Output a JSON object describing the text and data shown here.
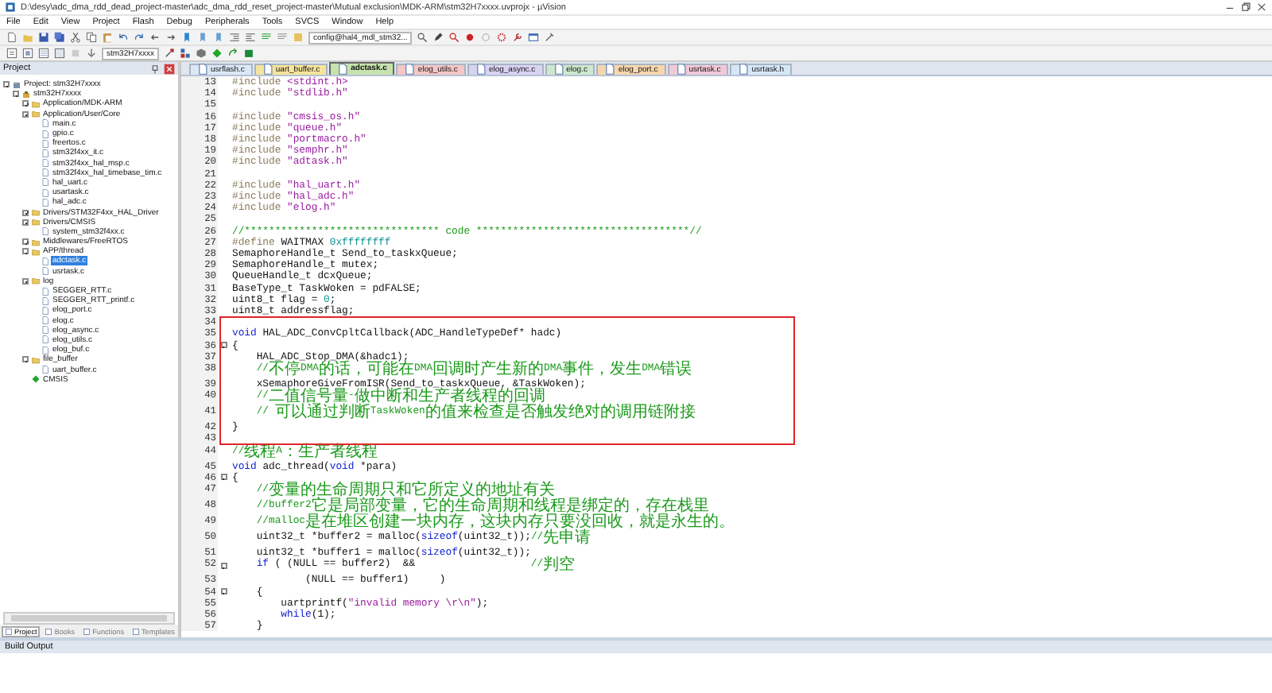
{
  "window": {
    "title": "D:\\desy\\adc_dma_rdd_dead_project-master\\adc_dma_rdd_reset_project-master\\Mutual exclusion\\MDK-ARM\\stm32H7xxxx.uvprojx - µVision"
  },
  "menu": [
    "File",
    "Edit",
    "View",
    "Project",
    "Flash",
    "Debug",
    "Peripherals",
    "Tools",
    "SVCS",
    "Window",
    "Help"
  ],
  "toolbar": {
    "config_field": "config@hal4_mdl_stm32...",
    "target_field": "stm32H7xxxx"
  },
  "project_panel": {
    "title": "Project",
    "tree": [
      {
        "label": "Project: stm32H7xxxx",
        "kind": "project",
        "expanded": true,
        "selected": false,
        "children": [
          {
            "label": "stm32H7xxxx",
            "kind": "target",
            "expanded": true,
            "selected": false,
            "children": [
              {
                "label": "Application/MDK-ARM",
                "kind": "folder",
                "expanded": false,
                "selected": false
              },
              {
                "label": "Application/User/Core",
                "kind": "folder",
                "expanded": true,
                "selected": false,
                "children": [
                  {
                    "label": "main.c",
                    "kind": "file",
                    "selected": false
                  },
                  {
                    "label": "gpio.c",
                    "kind": "file",
                    "selected": false
                  },
                  {
                    "label": "freertos.c",
                    "kind": "file",
                    "selected": false
                  },
                  {
                    "label": "stm32f4xx_it.c",
                    "kind": "file",
                    "selected": false
                  },
                  {
                    "label": "stm32f4xx_hal_msp.c",
                    "kind": "file",
                    "selected": false
                  },
                  {
                    "label": "stm32f4xx_hal_timebase_tim.c",
                    "kind": "file",
                    "selected": false
                  },
                  {
                    "label": "hal_uart.c",
                    "kind": "file",
                    "selected": false
                  },
                  {
                    "label": "usartask.c",
                    "kind": "file",
                    "selected": false
                  },
                  {
                    "label": "hal_adc.c",
                    "kind": "file",
                    "selected": false
                  }
                ]
              },
              {
                "label": "Drivers/STM32F4xx_HAL_Driver",
                "kind": "folder",
                "expanded": false,
                "selected": false
              },
              {
                "label": "Drivers/CMSIS",
                "kind": "folder",
                "expanded": true,
                "selected": false,
                "children": [
                  {
                    "label": "system_stm32f4xx.c",
                    "kind": "file",
                    "selected": false
                  }
                ]
              },
              {
                "label": "Middlewares/FreeRTOS",
                "kind": "folder",
                "expanded": false,
                "selected": false
              },
              {
                "label": "APP/thread",
                "kind": "folder",
                "expanded": true,
                "selected": false,
                "children": [
                  {
                    "label": "adctask.c",
                    "kind": "file",
                    "selected": true
                  },
                  {
                    "label": "usrtask.c",
                    "kind": "file",
                    "selected": false
                  }
                ]
              },
              {
                "label": "log",
                "kind": "folder",
                "expanded": true,
                "selected": false,
                "children": [
                  {
                    "label": "SEGGER_RTT.c",
                    "kind": "file",
                    "selected": false
                  },
                  {
                    "label": "SEGGER_RTT_printf.c",
                    "kind": "file",
                    "selected": false
                  },
                  {
                    "label": "elog_port.c",
                    "kind": "file",
                    "selected": false
                  },
                  {
                    "label": "elog.c",
                    "kind": "file",
                    "selected": false
                  },
                  {
                    "label": "elog_async.c",
                    "kind": "file",
                    "selected": false
                  },
                  {
                    "label": "elog_utils.c",
                    "kind": "file",
                    "selected": false
                  },
                  {
                    "label": "elog_buf.c",
                    "kind": "file",
                    "selected": false
                  }
                ]
              },
              {
                "label": "file_buffer",
                "kind": "folder",
                "expanded": true,
                "selected": false,
                "children": [
                  {
                    "label": "uart_buffer.c",
                    "kind": "file",
                    "selected": false
                  }
                ]
              },
              {
                "label": "CMSIS",
                "kind": "component",
                "selected": false
              }
            ]
          }
        ]
      }
    ],
    "tabs": [
      {
        "label": "Project",
        "selected": true
      },
      {
        "label": "Books",
        "selected": false
      },
      {
        "label": "Functions",
        "selected": false
      },
      {
        "label": "Templates",
        "selected": false
      }
    ]
  },
  "editor_tabs": [
    {
      "label": "usrflash.c",
      "selected": false,
      "color": "#dce8f6"
    },
    {
      "label": "uart_buffer.c",
      "selected": false,
      "color": "#f6e49c"
    },
    {
      "label": "adctask.c",
      "selected": true,
      "color": "#c6e3ad"
    },
    {
      "label": "elog_utils.c",
      "selected": false,
      "color": "#f4c6c6"
    },
    {
      "label": "elog_async.c",
      "selected": false,
      "color": "#d9d2f2"
    },
    {
      "label": "elog.c",
      "selected": false,
      "color": "#cde8cd"
    },
    {
      "label": "elog_port.c",
      "selected": false,
      "color": "#f7d6ae"
    },
    {
      "label": "usrtask.c",
      "selected": false,
      "color": "#f1c8d8"
    },
    {
      "label": "usrtask.h",
      "selected": false,
      "color": "#d6e7f8"
    }
  ],
  "code": {
    "before": [
      {
        "n": "13",
        "fold": false,
        "segs": [
          {
            "kind": "pp",
            "text": "#include "
          },
          {
            "kind": "str",
            "text": "<stdint.h>"
          }
        ]
      },
      {
        "n": "14",
        "fold": false,
        "segs": [
          {
            "kind": "pp",
            "text": "#include "
          },
          {
            "kind": "str",
            "text": "\"stdlib.h\""
          }
        ]
      },
      {
        "n": "15",
        "fold": false
      },
      {
        "n": "16",
        "fold": false,
        "segs": [
          {
            "kind": "pp",
            "text": "#include "
          },
          {
            "kind": "str",
            "text": "\"cmsis_os.h\""
          }
        ]
      },
      {
        "n": "17",
        "fold": false,
        "segs": [
          {
            "kind": "pp",
            "text": "#include "
          },
          {
            "kind": "str",
            "text": "\"queue.h\""
          }
        ]
      },
      {
        "n": "18",
        "fold": false,
        "segs": [
          {
            "kind": "pp",
            "text": "#include "
          },
          {
            "kind": "str",
            "text": "\"portmacro.h\""
          }
        ]
      },
      {
        "n": "19",
        "fold": false,
        "segs": [
          {
            "kind": "pp",
            "text": "#include "
          },
          {
            "kind": "str",
            "text": "\"semphr.h\""
          }
        ]
      },
      {
        "n": "20",
        "fold": false,
        "segs": [
          {
            "kind": "pp",
            "text": "#include "
          },
          {
            "kind": "str",
            "text": "\"adtask.h\""
          }
        ]
      },
      {
        "n": "21",
        "fold": false
      },
      {
        "n": "22",
        "fold": false,
        "segs": [
          {
            "kind": "pp",
            "text": "#include "
          },
          {
            "kind": "str",
            "text": "\"hal_uart.h\""
          }
        ]
      },
      {
        "n": "23",
        "fold": false,
        "segs": [
          {
            "kind": "pp",
            "text": "#include "
          },
          {
            "kind": "str",
            "text": "\"hal_adc.h\""
          }
        ]
      },
      {
        "n": "24",
        "fold": false,
        "segs": [
          {
            "kind": "pp",
            "text": "#include "
          },
          {
            "kind": "str",
            "text": "\"elog.h\""
          }
        ]
      },
      {
        "n": "25",
        "fold": false
      },
      {
        "n": "26",
        "fold": false,
        "segs": [
          {
            "kind": "cmt",
            "text": "//******************************** code ***********************************//"
          }
        ]
      },
      {
        "n": "27",
        "fold": false,
        "segs": [
          {
            "kind": "pp",
            "text": "#define "
          },
          {
            "kind": "plain",
            "text": "WAITMAX "
          },
          {
            "kind": "num",
            "text": "0xffffffff"
          }
        ]
      },
      {
        "n": "28",
        "fold": false,
        "segs": [
          {
            "kind": "plain",
            "text": "SemaphoreHandle_t Send_to_taskxQueue;"
          }
        ]
      },
      {
        "n": "29",
        "fold": false,
        "segs": [
          {
            "kind": "plain",
            "text": "SemaphoreHandle_t mutex;"
          }
        ]
      },
      {
        "n": "30",
        "fold": false,
        "segs": [
          {
            "kind": "plain",
            "text": "QueueHandle_t dcxQueue;"
          }
        ]
      },
      {
        "n": "31",
        "fold": false,
        "segs": [
          {
            "kind": "plain",
            "text": "BaseType_t TaskWoken = pdFALSE;"
          }
        ]
      },
      {
        "n": "32",
        "fold": false,
        "segs": [
          {
            "kind": "plain",
            "text": "uint8_t flag = "
          },
          {
            "kind": "num",
            "text": "0"
          },
          {
            "kind": "plain",
            "text": ";"
          }
        ]
      },
      {
        "n": "33",
        "fold": false,
        "segs": [
          {
            "kind": "plain",
            "text": "uint8_t addressflag;"
          }
        ]
      }
    ],
    "boxed": [
      {
        "n": "34",
        "fold": false
      },
      {
        "n": "35",
        "fold": false,
        "segs": [
          {
            "kind": "kw",
            "text": "void "
          },
          {
            "kind": "plain",
            "text": "HAL_ADC_ConvCpltCallback(ADC_HandleTypeDef* hadc)"
          }
        ]
      },
      {
        "n": "36",
        "fold": true,
        "segs": [
          {
            "kind": "plain",
            "text": "{"
          }
        ]
      },
      {
        "n": "37",
        "fold": false,
        "segs": [
          {
            "kind": "plain",
            "text": "    HAL_ADC_Stop_DMA(&hadc1);"
          }
        ]
      },
      {
        "n": "38",
        "fold": false,
        "segs": [
          {
            "kind": "cmt",
            "text": "    //不停DMA的话，可能在DMA回调时产生新的DMA事件，发生DMA错误"
          }
        ]
      },
      {
        "n": "39",
        "fold": false,
        "segs": [
          {
            "kind": "plain",
            "text": "    xSemaphoreGiveFromISR(Send_to_taskxQueue, &TaskWoken);"
          }
        ]
      },
      {
        "n": "40",
        "fold": false,
        "segs": [
          {
            "kind": "cmt",
            "text": "    //二值信号量-做中断和生产者线程的回调"
          }
        ]
      },
      {
        "n": "41",
        "fold": false,
        "segs": [
          {
            "kind": "cmt",
            "text": "    // 可以通过判断TaskWoken的值来检查是否触发绝对的调用链附接"
          }
        ]
      },
      {
        "n": "42",
        "fold": false,
        "segs": [
          {
            "kind": "plain",
            "text": "}"
          }
        ]
      },
      {
        "n": "43",
        "fold": false
      }
    ],
    "after": [
      {
        "n": "44",
        "fold": false,
        "segs": [
          {
            "kind": "cmt",
            "text": "//线程A：生产者线程"
          }
        ]
      },
      {
        "n": "45",
        "fold": false,
        "segs": [
          {
            "kind": "kw",
            "text": "void "
          },
          {
            "kind": "plain",
            "text": "adc_thread("
          },
          {
            "kind": "kw",
            "text": "void"
          },
          {
            "kind": "plain",
            "text": " *para)"
          }
        ]
      },
      {
        "n": "46",
        "fold": true,
        "segs": [
          {
            "kind": "plain",
            "text": "{"
          }
        ]
      },
      {
        "n": "47",
        "fold": false,
        "segs": [
          {
            "kind": "cmt",
            "text": "    //变量的生命周期只和它所定义的地址有关"
          }
        ]
      },
      {
        "n": "48",
        "fold": false,
        "segs": [
          {
            "kind": "cmt",
            "text": "    //buffer2它是局部变量，它的生命周期和线程是绑定的，存在栈里"
          }
        ]
      },
      {
        "n": "49",
        "fold": false,
        "segs": [
          {
            "kind": "cmt",
            "text": "    //malloc是在堆区创建一块内存，这块内存只要没回收，就是永生的。"
          }
        ]
      },
      {
        "n": "50",
        "fold": false,
        "segs": [
          {
            "kind": "plain",
            "text": "    uint32_t *buffer2 = malloc("
          },
          {
            "kind": "kw",
            "text": "sizeof"
          },
          {
            "kind": "plain",
            "text": "(uint32_t));"
          },
          {
            "kind": "cmt",
            "text": "//先申请"
          }
        ]
      },
      {
        "n": "51",
        "fold": false,
        "segs": [
          {
            "kind": "plain",
            "text": "    uint32_t *buffer1 = malloc("
          },
          {
            "kind": "kw",
            "text": "sizeof"
          },
          {
            "kind": "plain",
            "text": "(uint32_t));"
          }
        ]
      },
      {
        "n": "52",
        "fold": true,
        "segs": [
          {
            "kind": "kw",
            "text": "    if"
          },
          {
            "kind": "plain",
            "text": " ( (NULL == buffer2)  &&                   "
          },
          {
            "kind": "cmt",
            "text": "//判空"
          }
        ]
      },
      {
        "n": "53",
        "fold": false,
        "segs": [
          {
            "kind": "plain",
            "text": "            (NULL == buffer1)     )"
          }
        ]
      },
      {
        "n": "54",
        "fold": true,
        "segs": [
          {
            "kind": "plain",
            "text": "    {"
          }
        ]
      },
      {
        "n": "55",
        "fold": false,
        "segs": [
          {
            "kind": "plain",
            "text": "        uartprintf("
          },
          {
            "kind": "str",
            "text": "\"invalid memory \\r\\n\""
          },
          {
            "kind": "plain",
            "text": ");"
          }
        ]
      },
      {
        "n": "56",
        "fold": false,
        "segs": [
          {
            "kind": "kw",
            "text": "        while"
          },
          {
            "kind": "plain",
            "text": "(1);"
          }
        ]
      },
      {
        "n": "57",
        "fold": false,
        "segs": [
          {
            "kind": "plain",
            "text": "    }"
          }
        ]
      }
    ]
  },
  "build_output": {
    "title": "Build Output"
  }
}
